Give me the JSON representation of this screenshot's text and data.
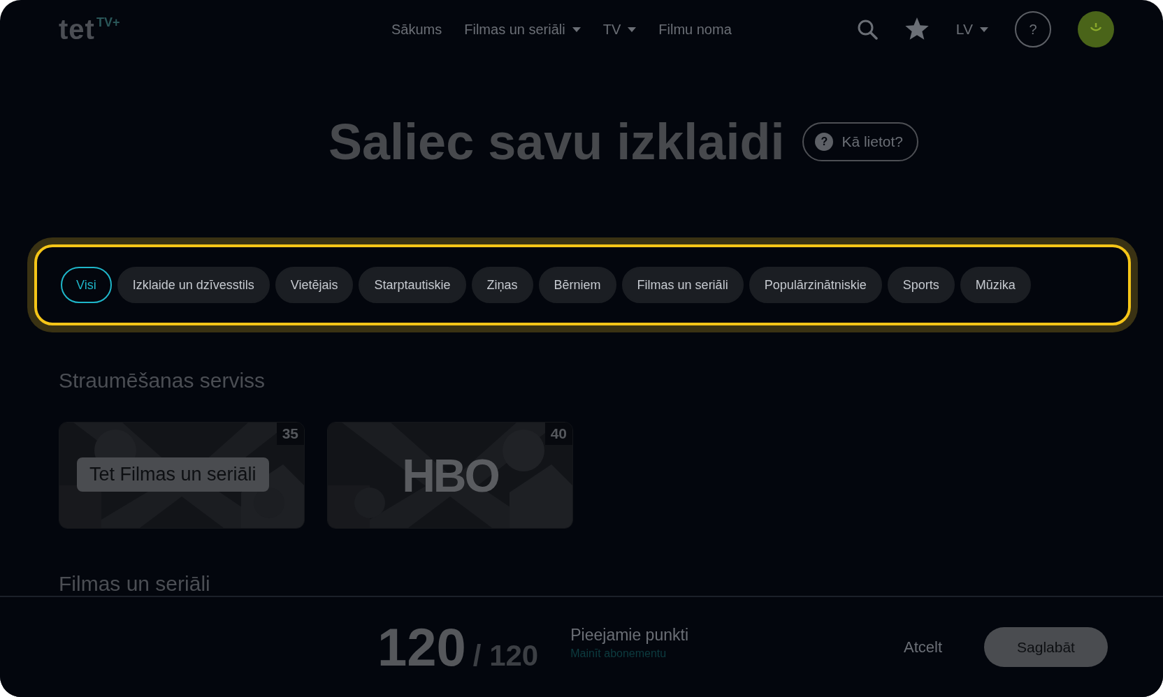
{
  "header": {
    "logo": {
      "main": "tet",
      "sup": "TV+"
    },
    "nav": [
      {
        "label": "Sākums",
        "dropdown": false
      },
      {
        "label": "Filmas un seriāli",
        "dropdown": true
      },
      {
        "label": "TV",
        "dropdown": true
      },
      {
        "label": "Filmu noma",
        "dropdown": false
      }
    ],
    "language": "LV",
    "help": "?"
  },
  "hero": {
    "title": "Saliec savu izklaidi",
    "help_icon": "?",
    "help_button": "Kā lietot?"
  },
  "filters": [
    {
      "label": "Visi",
      "selected": true
    },
    {
      "label": "Izklaide un dzīvesstils",
      "selected": false
    },
    {
      "label": "Vietējais",
      "selected": false
    },
    {
      "label": "Starptautiskie",
      "selected": false
    },
    {
      "label": "Ziņas",
      "selected": false
    },
    {
      "label": "Bērniem",
      "selected": false
    },
    {
      "label": "Filmas un seriāli",
      "selected": false
    },
    {
      "label": "Populārzinātniskie",
      "selected": false
    },
    {
      "label": "Sports",
      "selected": false
    },
    {
      "label": "Mūzika",
      "selected": false
    }
  ],
  "sections": [
    {
      "title": "Straumēšanas serviss",
      "cards": [
        {
          "kind": "badge",
          "label": "Tet Filmas un seriāli",
          "count": "35"
        },
        {
          "kind": "wordmark",
          "label": "HBO",
          "count": "40"
        }
      ]
    },
    {
      "title": "Filmas un seriāli"
    }
  ],
  "footer": {
    "points": "120",
    "total": "/ 120",
    "points_label": "Pieejamie punkti",
    "change_link": "Mainīt abonementu",
    "cancel": "Atcelt",
    "save": "Saglabāt"
  }
}
